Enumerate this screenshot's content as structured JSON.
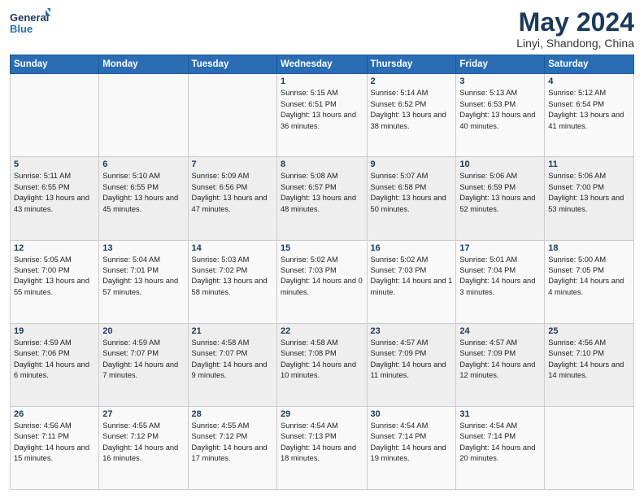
{
  "header": {
    "logo_line1": "General",
    "logo_line2": "Blue",
    "month": "May 2024",
    "location": "Linyi, Shandong, China"
  },
  "weekdays": [
    "Sunday",
    "Monday",
    "Tuesday",
    "Wednesday",
    "Thursday",
    "Friday",
    "Saturday"
  ],
  "weeks": [
    [
      {
        "day": "",
        "info": ""
      },
      {
        "day": "",
        "info": ""
      },
      {
        "day": "",
        "info": ""
      },
      {
        "day": "1",
        "info": "Sunrise: 5:15 AM\nSunset: 6:51 PM\nDaylight: 13 hours and 36 minutes."
      },
      {
        "day": "2",
        "info": "Sunrise: 5:14 AM\nSunset: 6:52 PM\nDaylight: 13 hours and 38 minutes."
      },
      {
        "day": "3",
        "info": "Sunrise: 5:13 AM\nSunset: 6:53 PM\nDaylight: 13 hours and 40 minutes."
      },
      {
        "day": "4",
        "info": "Sunrise: 5:12 AM\nSunset: 6:54 PM\nDaylight: 13 hours and 41 minutes."
      }
    ],
    [
      {
        "day": "5",
        "info": "Sunrise: 5:11 AM\nSunset: 6:55 PM\nDaylight: 13 hours and 43 minutes."
      },
      {
        "day": "6",
        "info": "Sunrise: 5:10 AM\nSunset: 6:55 PM\nDaylight: 13 hours and 45 minutes."
      },
      {
        "day": "7",
        "info": "Sunrise: 5:09 AM\nSunset: 6:56 PM\nDaylight: 13 hours and 47 minutes."
      },
      {
        "day": "8",
        "info": "Sunrise: 5:08 AM\nSunset: 6:57 PM\nDaylight: 13 hours and 48 minutes."
      },
      {
        "day": "9",
        "info": "Sunrise: 5:07 AM\nSunset: 6:58 PM\nDaylight: 13 hours and 50 minutes."
      },
      {
        "day": "10",
        "info": "Sunrise: 5:06 AM\nSunset: 6:59 PM\nDaylight: 13 hours and 52 minutes."
      },
      {
        "day": "11",
        "info": "Sunrise: 5:06 AM\nSunset: 7:00 PM\nDaylight: 13 hours and 53 minutes."
      }
    ],
    [
      {
        "day": "12",
        "info": "Sunrise: 5:05 AM\nSunset: 7:00 PM\nDaylight: 13 hours and 55 minutes."
      },
      {
        "day": "13",
        "info": "Sunrise: 5:04 AM\nSunset: 7:01 PM\nDaylight: 13 hours and 57 minutes."
      },
      {
        "day": "14",
        "info": "Sunrise: 5:03 AM\nSunset: 7:02 PM\nDaylight: 13 hours and 58 minutes."
      },
      {
        "day": "15",
        "info": "Sunrise: 5:02 AM\nSunset: 7:03 PM\nDaylight: 14 hours and 0 minutes."
      },
      {
        "day": "16",
        "info": "Sunrise: 5:02 AM\nSunset: 7:03 PM\nDaylight: 14 hours and 1 minute."
      },
      {
        "day": "17",
        "info": "Sunrise: 5:01 AM\nSunset: 7:04 PM\nDaylight: 14 hours and 3 minutes."
      },
      {
        "day": "18",
        "info": "Sunrise: 5:00 AM\nSunset: 7:05 PM\nDaylight: 14 hours and 4 minutes."
      }
    ],
    [
      {
        "day": "19",
        "info": "Sunrise: 4:59 AM\nSunset: 7:06 PM\nDaylight: 14 hours and 6 minutes."
      },
      {
        "day": "20",
        "info": "Sunrise: 4:59 AM\nSunset: 7:07 PM\nDaylight: 14 hours and 7 minutes."
      },
      {
        "day": "21",
        "info": "Sunrise: 4:58 AM\nSunset: 7:07 PM\nDaylight: 14 hours and 9 minutes."
      },
      {
        "day": "22",
        "info": "Sunrise: 4:58 AM\nSunset: 7:08 PM\nDaylight: 14 hours and 10 minutes."
      },
      {
        "day": "23",
        "info": "Sunrise: 4:57 AM\nSunset: 7:09 PM\nDaylight: 14 hours and 11 minutes."
      },
      {
        "day": "24",
        "info": "Sunrise: 4:57 AM\nSunset: 7:09 PM\nDaylight: 14 hours and 12 minutes."
      },
      {
        "day": "25",
        "info": "Sunrise: 4:56 AM\nSunset: 7:10 PM\nDaylight: 14 hours and 14 minutes."
      }
    ],
    [
      {
        "day": "26",
        "info": "Sunrise: 4:56 AM\nSunset: 7:11 PM\nDaylight: 14 hours and 15 minutes."
      },
      {
        "day": "27",
        "info": "Sunrise: 4:55 AM\nSunset: 7:12 PM\nDaylight: 14 hours and 16 minutes."
      },
      {
        "day": "28",
        "info": "Sunrise: 4:55 AM\nSunset: 7:12 PM\nDaylight: 14 hours and 17 minutes."
      },
      {
        "day": "29",
        "info": "Sunrise: 4:54 AM\nSunset: 7:13 PM\nDaylight: 14 hours and 18 minutes."
      },
      {
        "day": "30",
        "info": "Sunrise: 4:54 AM\nSunset: 7:14 PM\nDaylight: 14 hours and 19 minutes."
      },
      {
        "day": "31",
        "info": "Sunrise: 4:54 AM\nSunset: 7:14 PM\nDaylight: 14 hours and 20 minutes."
      },
      {
        "day": "",
        "info": ""
      }
    ]
  ]
}
